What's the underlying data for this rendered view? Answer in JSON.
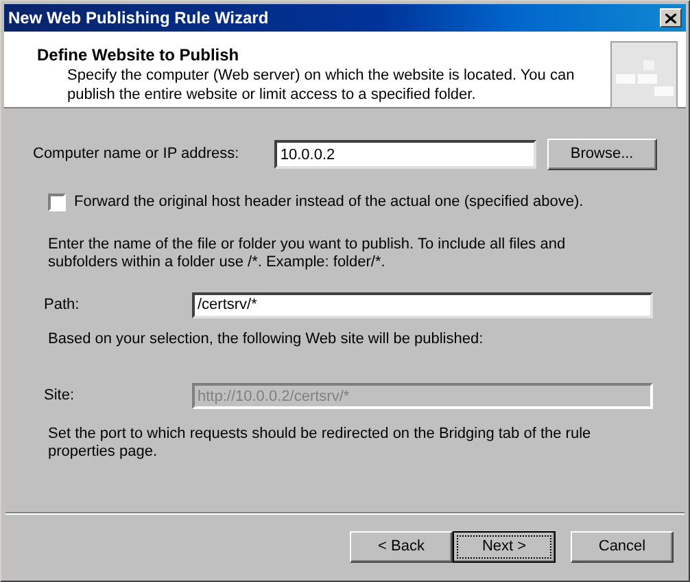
{
  "window": {
    "title": "New Web Publishing Rule Wizard"
  },
  "header": {
    "title": "Define Website to Publish",
    "description": "Specify the computer (Web server) on which the website is located. You can publish the entire website or limit access to a specified folder."
  },
  "computer": {
    "label": "Computer name or IP address:",
    "value": "10.0.0.2",
    "button": "Browse..."
  },
  "forward_host_header": {
    "label": "Forward the original host header instead of the actual one (specified above).",
    "checked": false
  },
  "path_instructions": "Enter the name of the file or folder you want to publish. To include all files and subfolders within a folder use /*. Example: folder/*.",
  "path": {
    "label": "Path:",
    "value": "/certsrv/*"
  },
  "selection_note": "Based on your selection, the following Web site will be published:",
  "site": {
    "label": "Site:",
    "value": "http://10.0.0.2/certsrv/*",
    "disabled": true
  },
  "port_note": "Set the port to which requests should be redirected on the Bridging tab of the rule properties page.",
  "buttons": [
    {
      "label": "< Back",
      "default": false
    },
    {
      "label": "Next >",
      "default": true
    },
    {
      "label": "Cancel",
      "default": false
    }
  ]
}
